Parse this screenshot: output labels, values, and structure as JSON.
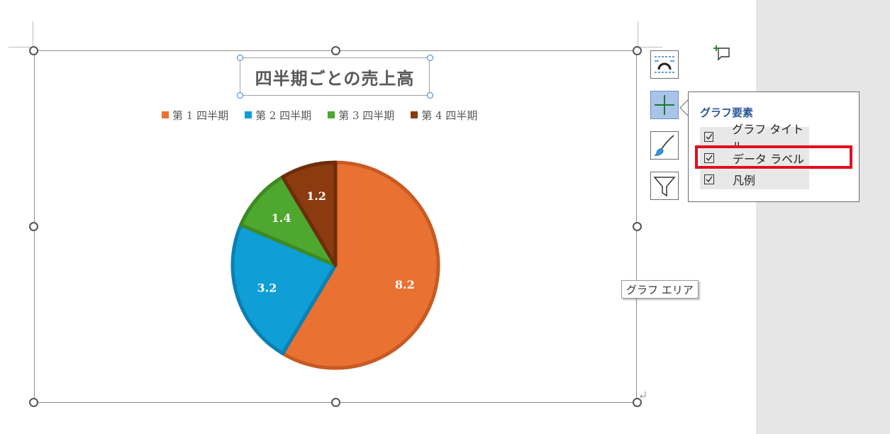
{
  "chart_title": "四半期ごとの売上高",
  "legend": [
    {
      "label": "第 1 四半期",
      "color": "#e97132"
    },
    {
      "label": "第 2 四半期",
      "color": "#0f9ed5"
    },
    {
      "label": "第 3 四半期",
      "color": "#4ea72e"
    },
    {
      "label": "第 4 四半期",
      "color": "#8b3b0f"
    }
  ],
  "chart_data": {
    "type": "pie",
    "title": "四半期ごとの売上高",
    "categories": [
      "第 1 四半期",
      "第 2 四半期",
      "第 3 四半期",
      "第 4 四半期"
    ],
    "values": [
      8.2,
      3.2,
      1.4,
      1.2
    ],
    "value_labels": [
      "8.2",
      "3.2",
      "1.4",
      "1.2"
    ],
    "colors": [
      "#e97132",
      "#0f9ed5",
      "#4ea72e",
      "#8b3b0f"
    ],
    "legend_position": "top",
    "start_angle_deg": 0
  },
  "side_buttons": [
    {
      "icon": "layout-options-icon"
    },
    {
      "icon": "chart-elements-plus-icon",
      "active": true
    },
    {
      "icon": "chart-styles-brush-icon"
    },
    {
      "icon": "chart-filters-funnel-icon"
    }
  ],
  "popup": {
    "title": "グラフ要素",
    "items": [
      {
        "label": "グラフ タイトル",
        "checked": true
      },
      {
        "label": "データ ラベル",
        "checked": true
      },
      {
        "label": "凡例",
        "checked": true
      }
    ]
  },
  "tooltip": "グラフ エリア",
  "highlight_color": "#e0101e"
}
